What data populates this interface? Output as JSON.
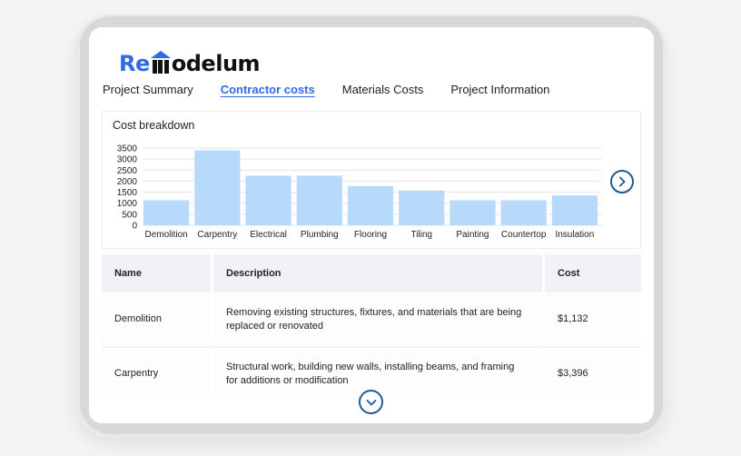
{
  "logo": {
    "part1": "Re",
    "part2": "odelum"
  },
  "tabs": [
    {
      "label": "Project Summary",
      "active": false
    },
    {
      "label": "Contractor costs",
      "active": true
    },
    {
      "label": "Materials Costs",
      "active": false
    },
    {
      "label": "Project Information",
      "active": false
    }
  ],
  "chart": {
    "title": "Cost breakdown"
  },
  "chart_data": {
    "type": "bar",
    "title": "Cost breakdown",
    "categories": [
      "Demolition",
      "Carpentry",
      "Electrical",
      "Plumbing",
      "Flooring",
      "Tiling",
      "Painting",
      "Countertop",
      "Insulation"
    ],
    "values": [
      1132,
      3396,
      2250,
      2250,
      1780,
      1570,
      1130,
      1130,
      1350
    ],
    "yticks": [
      0,
      500,
      1000,
      1500,
      2000,
      2500,
      3000,
      3500
    ],
    "ylim": [
      0,
      3500
    ],
    "xlabel": "",
    "ylabel": "",
    "grid": true,
    "bar_color": "#b7dafa"
  },
  "table": {
    "headers": {
      "name": "Name",
      "description": "Description",
      "cost": "Cost"
    },
    "rows": [
      {
        "name": "Demolition",
        "description": "Removing existing structures, fixtures, and materials that are being replaced or renovated",
        "cost": "$1,132"
      },
      {
        "name": "Carpentry",
        "description": "Structural work, building new walls, installing beams, and framing for additions or modification",
        "cost": "$3,396"
      }
    ]
  },
  "colors": {
    "accent": "#2f6be4",
    "nav_circle": "#1f5a93",
    "header_bg": "#f1f1f6"
  }
}
